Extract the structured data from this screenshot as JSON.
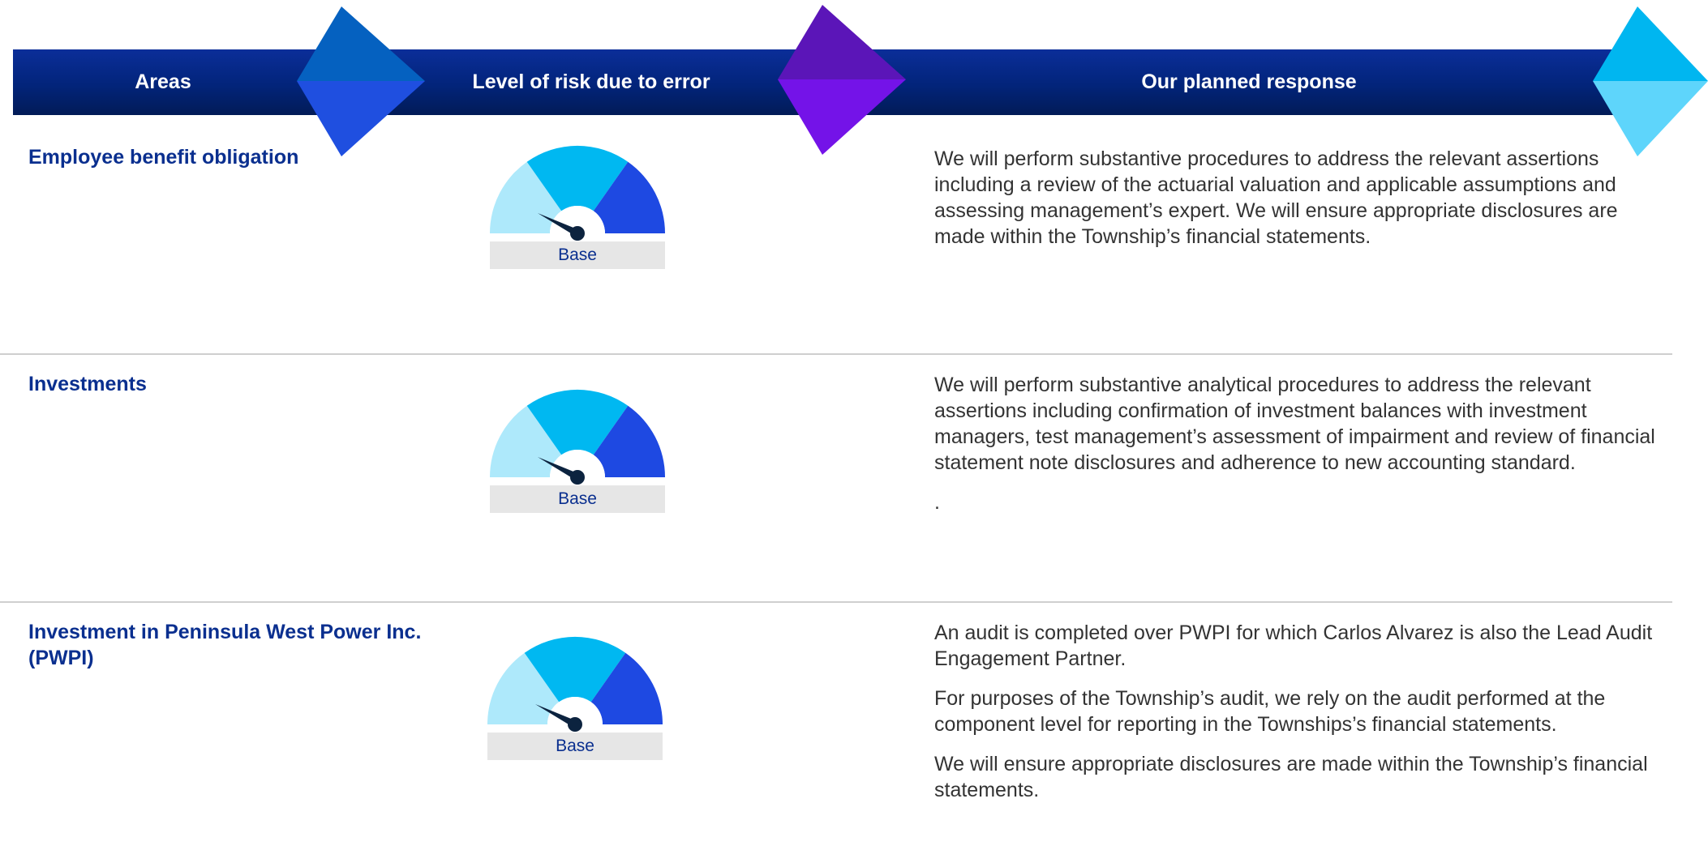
{
  "header": {
    "areas": "Areas",
    "level_of_risk": "Level of risk due to error",
    "planned_response": "Our planned response"
  },
  "colors": {
    "band_dark": "#021b57",
    "band_blue": "#0b2e99",
    "area_title": "#0a2f8f",
    "gauge_light": "#aee9fb",
    "gauge_mid": "#00b8f1",
    "gauge_dark": "#1e49e2",
    "needle": "#0c233f"
  },
  "rows": [
    {
      "area": "Employee benefit obligation",
      "risk": "Base",
      "response": [
        "We will perform substantive procedures to address the relevant assertions including a review of the actuarial valuation and applicable assumptions and assessing management’s expert. We will ensure appropriate disclosures are made within the Township’s financial statements."
      ]
    },
    {
      "area": "Investments",
      "risk": "Base",
      "response": [
        "We will perform substantive analytical procedures to address the relevant assertions including confirmation of investment balances with investment managers, test management’s assessment of impairment and review of financial statement note disclosures and adherence to new accounting standard.",
        "."
      ]
    },
    {
      "area": "Investment in Peninsula West Power Inc. (PWPI)",
      "risk": "Base",
      "response": [
        "An audit is completed over PWPI for which Carlos Alvarez is also the Lead Audit Engagement Partner.",
        "For purposes of the Township’s audit, we rely on the audit performed at the component level for reporting in the Townships’s financial statements.",
        "We will ensure appropriate disclosures are made within the Township’s financial statements."
      ]
    }
  ]
}
